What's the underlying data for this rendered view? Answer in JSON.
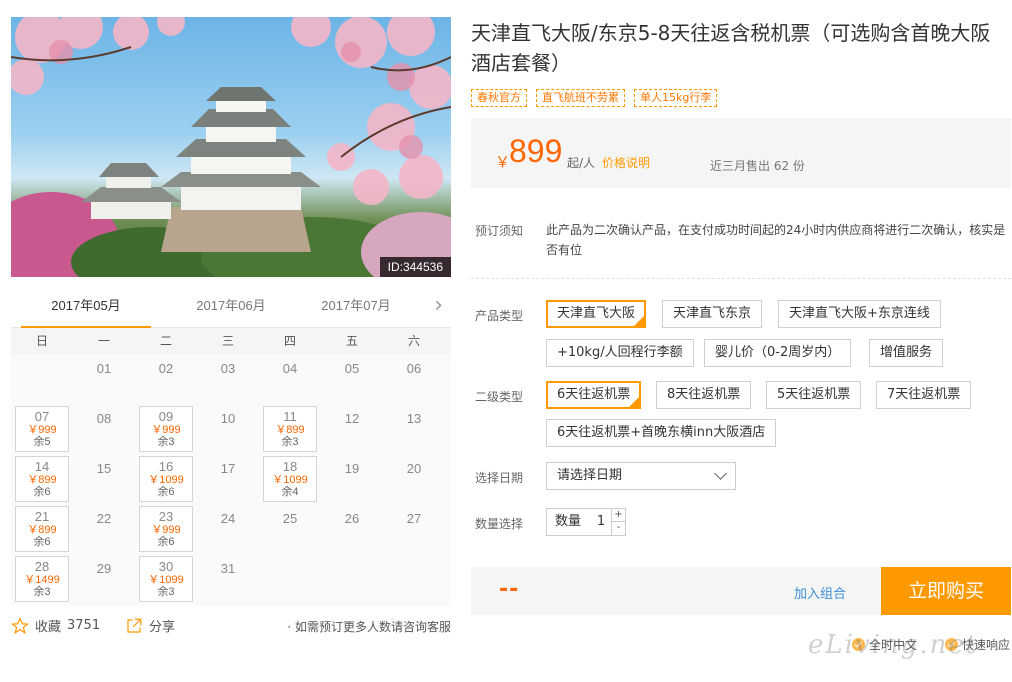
{
  "hero": {
    "id_label": "ID:344536"
  },
  "calendar": {
    "months": [
      "2017年05月",
      "2017年06月",
      "2017年07月"
    ],
    "active_month": 0,
    "weekdays": [
      "日",
      "一",
      "二",
      "三",
      "四",
      "五",
      "六"
    ],
    "days": [
      {
        "d": ""
      },
      {
        "d": "01"
      },
      {
        "d": "02"
      },
      {
        "d": "03"
      },
      {
        "d": "04"
      },
      {
        "d": "05"
      },
      {
        "d": "06"
      },
      {
        "d": "07",
        "price": "￥999",
        "stock": "余5"
      },
      {
        "d": "08"
      },
      {
        "d": "09",
        "price": "￥999",
        "stock": "余3"
      },
      {
        "d": "10"
      },
      {
        "d": "11",
        "price": "￥899",
        "stock": "余3"
      },
      {
        "d": "12"
      },
      {
        "d": "13"
      },
      {
        "d": "14",
        "price": "￥899",
        "stock": "余6"
      },
      {
        "d": "15"
      },
      {
        "d": "16",
        "price": "￥1099",
        "stock": "余6"
      },
      {
        "d": "17"
      },
      {
        "d": "18",
        "price": "￥1099",
        "stock": "余4"
      },
      {
        "d": "19"
      },
      {
        "d": "20"
      },
      {
        "d": "21",
        "price": "￥899",
        "stock": "余6"
      },
      {
        "d": "22"
      },
      {
        "d": "23",
        "price": "￥999",
        "stock": "余6"
      },
      {
        "d": "24"
      },
      {
        "d": "25"
      },
      {
        "d": "26"
      },
      {
        "d": "27"
      },
      {
        "d": "28",
        "price": "￥1499",
        "stock": "余3"
      },
      {
        "d": "29"
      },
      {
        "d": "30",
        "price": "￥1099",
        "stock": "余3"
      },
      {
        "d": "31"
      }
    ]
  },
  "footer": {
    "fav_label": "收藏",
    "fav_count": "3751",
    "share_label": "分享",
    "consult_text": "· 如需预订更多人数请咨询客服"
  },
  "product": {
    "title": "天津直飞大阪/东京5-8天往返含税机票（可选购含首晚大阪酒店套餐）",
    "tags": [
      "春秋官方",
      "直飞航班不劳累",
      "单人15kg行李"
    ],
    "yen": "￥",
    "price": "899",
    "price_unit": "起/人",
    "price_note": "价格说明",
    "sold": "近三月售出 62 份"
  },
  "booking": {
    "notice_label": "预订须知",
    "notice_text": "此产品为二次确认产品，在支付成功时间起的24小时内供应商将进行二次确认，核实是否有位",
    "type_label": "产品类型",
    "types": [
      "天津直飞大阪",
      "天津直飞东京",
      "天津直飞大阪+东京连线",
      "+10kg/人回程行李额",
      "婴儿价（0-2周岁内）",
      "增值服务"
    ],
    "sub_label": "二级类型",
    "subtypes": [
      "6天往返机票",
      "8天往返机票",
      "5天往返机票",
      "7天往返机票",
      "6天往返机票+首晚东横inn大阪酒店"
    ],
    "date_label": "选择日期",
    "date_placeholder": "请选择日期",
    "qty_label": "数量选择",
    "qty_inner_label": "数量",
    "qty_value": "1",
    "qty_plus": "+",
    "qty_minus": "-"
  },
  "buybar": {
    "total": "--",
    "add_combo": "加入组合",
    "buy": "立即购买"
  },
  "assurance": [
    "全时中文",
    "快速响应"
  ],
  "watermark": "eLiving.net",
  "colors": {
    "accent": "#ff9900",
    "price": "#ff6600",
    "link": "#3b8fd8"
  }
}
